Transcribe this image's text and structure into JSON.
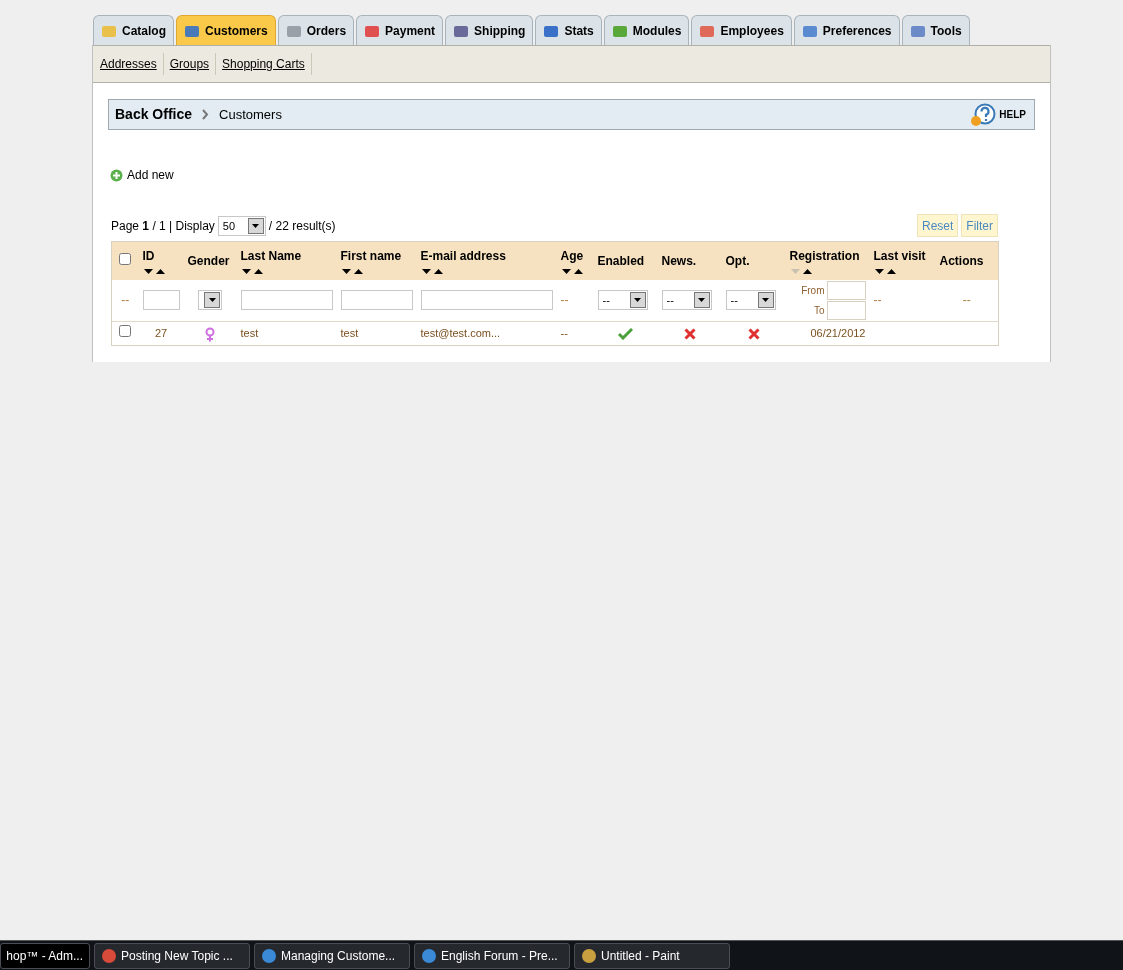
{
  "tabs": [
    {
      "label": "Catalog",
      "selected": false
    },
    {
      "label": "Customers",
      "selected": true
    },
    {
      "label": "Orders",
      "selected": false
    },
    {
      "label": "Payment",
      "selected": false
    },
    {
      "label": "Shipping",
      "selected": false
    },
    {
      "label": "Stats",
      "selected": false
    },
    {
      "label": "Modules",
      "selected": false
    },
    {
      "label": "Employees",
      "selected": false
    },
    {
      "label": "Preferences",
      "selected": false
    },
    {
      "label": "Tools",
      "selected": false
    }
  ],
  "subnav": [
    "Addresses",
    "Groups",
    "Shopping Carts"
  ],
  "breadcrumb": {
    "root": "Back Office",
    "current": "Customers",
    "help": "HELP"
  },
  "add_new": "Add new",
  "pagination": {
    "page": "Page **1** / 1 | Display",
    "display": "50",
    "results": "/ 22 result(s)"
  },
  "buttons": [
    "Reset",
    "Filter"
  ],
  "table": {
    "select_all": {
      "checked": false
    },
    "columns": [
      {
        "label": "ID",
        "sortable": true,
        "sorted": false
      },
      {
        "label": "Gender",
        "sortable": false
      },
      {
        "label": "Last Name",
        "sortable": true,
        "sorted": false
      },
      {
        "label": "First name",
        "sortable": true,
        "sorted": false
      },
      {
        "label": "E-mail address",
        "sortable": true,
        "sorted": false
      },
      {
        "label": "Age",
        "sortable": true,
        "sorted": false
      },
      {
        "label": "Enabled",
        "sortable": false
      },
      {
        "label": "News.",
        "sortable": false
      },
      {
        "label": "Opt.",
        "sortable": false
      },
      {
        "label": "Registration",
        "sortable": true,
        "sorted": true
      },
      {
        "label": "Last visit",
        "sortable": true,
        "sorted": false
      },
      {
        "label": "Actions",
        "sortable": false
      }
    ],
    "filters": [
      {
        "kind": "dash",
        "text": "--"
      },
      {
        "kind": "input"
      },
      {
        "kind": "select"
      },
      {
        "kind": "input"
      },
      {
        "kind": "input"
      },
      {
        "kind": "input"
      },
      {
        "kind": "dash",
        "text": "--"
      },
      {
        "kind": "select",
        "value": "--"
      },
      {
        "kind": "select",
        "value": "--"
      },
      {
        "kind": "select",
        "value": "--"
      },
      {
        "kind": "range",
        "from": "From",
        "to": "To"
      },
      {
        "kind": "dash",
        "text": "--"
      },
      {
        "kind": "dash",
        "text": "--"
      }
    ],
    "rows": [
      {
        "checked": false,
        "cells": [
          {
            "kind": "text",
            "value": "27"
          },
          {
            "kind": "gender"
          },
          {
            "kind": "text",
            "value": "test"
          },
          {
            "kind": "text",
            "value": "test"
          },
          {
            "kind": "text",
            "value": "test@test.com..."
          },
          {
            "kind": "text",
            "value": "--"
          },
          {
            "kind": "bool",
            "on": true
          },
          {
            "kind": "bool",
            "on": false
          },
          {
            "kind": "bool",
            "on": false
          },
          {
            "kind": "text",
            "value": "06/21/2012"
          },
          {
            "kind": "empty"
          },
          {
            "kind": "empty"
          }
        ]
      }
    ]
  },
  "taskbar": [
    {
      "label": "hop™ - Adm...",
      "selected": true
    },
    {
      "label": "Posting New Topic ...",
      "selected": false
    },
    {
      "label": "Managing Custome...",
      "selected": false
    },
    {
      "label": "English Forum - Pre...",
      "selected": false
    },
    {
      "label": "Untitled - Paint",
      "selected": false
    }
  ]
}
